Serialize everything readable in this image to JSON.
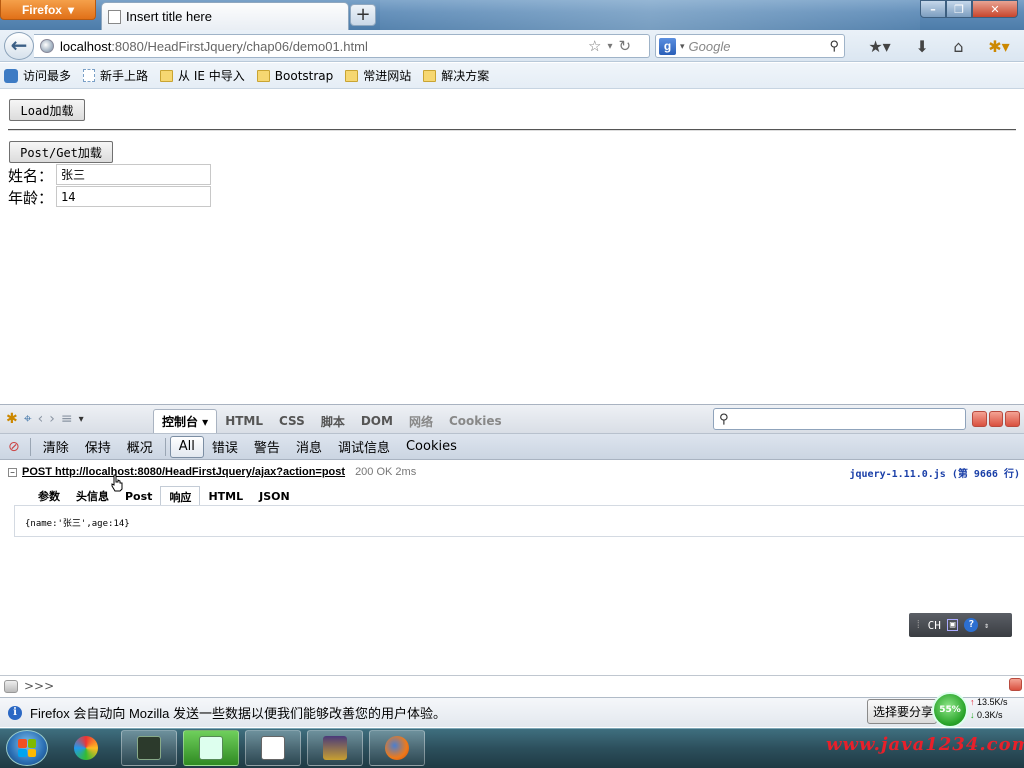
{
  "browser": {
    "app_button": "Firefox",
    "tab_title": "Insert title here",
    "new_tab": "+",
    "url_host": "localhost",
    "url_rest": ":8080/HeadFirstJquery/chap06/demo01.html",
    "search_placeholder": "Google",
    "bookmarks": [
      {
        "label": "访问最多",
        "icon": "magnifier-icon"
      },
      {
        "label": "新手上路",
        "icon": "page-icon"
      },
      {
        "label": "从 IE 中导入",
        "icon": "folder-icon"
      },
      {
        "label": "Bootstrap",
        "icon": "folder-icon"
      },
      {
        "label": "常进网站",
        "icon": "folder-icon"
      },
      {
        "label": "解决方案",
        "icon": "folder-icon"
      }
    ]
  },
  "page": {
    "load_button": "Load加载",
    "postget_button": "Post/Get加载",
    "name_label": "姓名：",
    "name_value": "张三",
    "age_label": "年龄：",
    "age_value": "14"
  },
  "firebug": {
    "tabs": [
      "控制台 ▾",
      "HTML",
      "CSS",
      "脚本",
      "DOM",
      "网络",
      "Cookies"
    ],
    "selected_tab": "控制台 ▾",
    "console_buttons": [
      "清除",
      "保持",
      "概况",
      "All",
      "错误",
      "警告",
      "消息",
      "调试信息",
      "Cookies"
    ],
    "selected_console_button": "All",
    "request": {
      "method_url": "POST http://localhost:8080/HeadFirstJquery/ajax?action=post",
      "status": "200 OK 2ms",
      "source": "jquery-1.11.0.js (第 9666 行)"
    },
    "request_tabs": [
      "参数",
      "头信息",
      "Post",
      "响应",
      "HTML",
      "JSON"
    ],
    "selected_request_tab": "响应",
    "response": "{name:'张三',age:14}",
    "command_prompt": ">>>"
  },
  "ime": {
    "label": "CH"
  },
  "notification": {
    "text": "Firefox 会自动向 Mozilla 发送一些数据以便我们能够改善您的用户体验。",
    "button": "选择要分享"
  },
  "network_meter": {
    "percent": "55%",
    "up": "13.5K/s",
    "down": "0.3K/s"
  },
  "watermark": "www.java1234.com",
  "colors": {
    "firefox_orange": "#e07018",
    "titlebar": "#5f8cb8",
    "watermark_red": "#e8202a",
    "link_blue": "#1a3fa8"
  }
}
